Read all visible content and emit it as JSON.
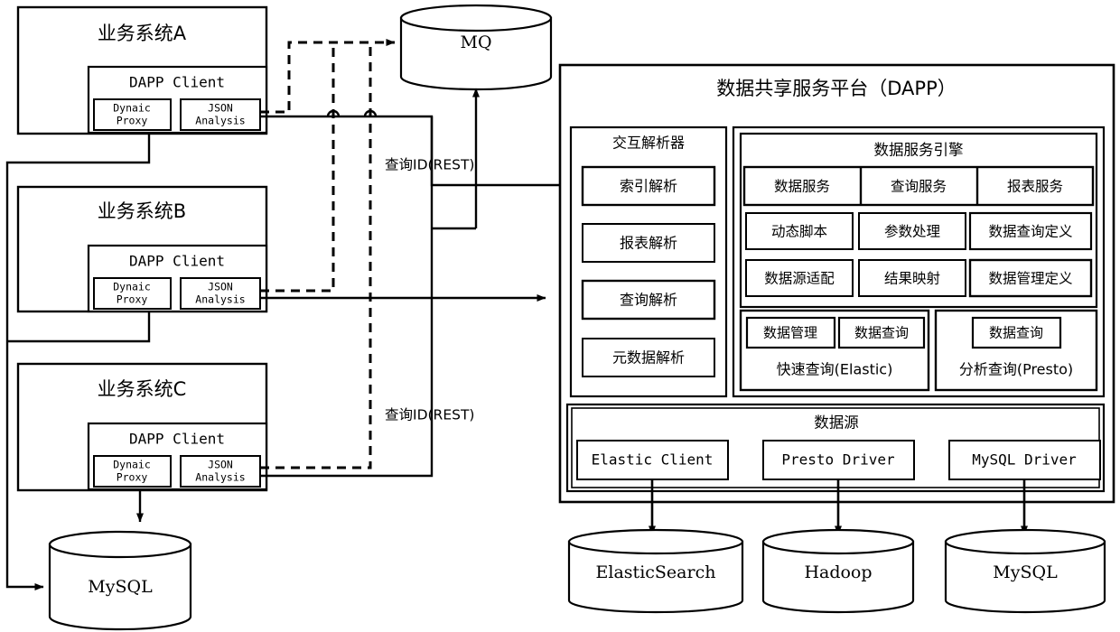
{
  "diagram": {
    "title_hidden": "",
    "colors": {
      "stroke": "#000000",
      "fill": "#ffffff"
    }
  },
  "business_systems": [
    {
      "id": "A",
      "title": "业务系统A",
      "client": {
        "title": "DAPP Client",
        "modules": [
          {
            "line1": "Dynaic",
            "line2": "Proxy"
          },
          {
            "line1": "JSON",
            "line2": "Analysis"
          }
        ]
      }
    },
    {
      "id": "B",
      "title": "业务系统B",
      "client": {
        "title": "DAPP Client",
        "modules": [
          {
            "line1": "Dynaic",
            "line2": "Proxy"
          },
          {
            "line1": "JSON",
            "line2": "Analysis"
          }
        ]
      }
    },
    {
      "id": "C",
      "title": "业务系统C",
      "client": {
        "title": "DAPP Client",
        "modules": [
          {
            "line1": "Dynaic",
            "line2": "Proxy"
          },
          {
            "line1": "JSON",
            "line2": "Analysis"
          }
        ]
      }
    }
  ],
  "queues": {
    "mq": "MQ"
  },
  "left_store": {
    "mysql": "MySQL"
  },
  "edge_labels": {
    "query_id_rest_top": "查询ID(REST)",
    "query_id_rest_bottom": "查询ID(REST)"
  },
  "platform": {
    "title": "数据共享服务平台（DAPP）",
    "parser": {
      "title": "交互解析器",
      "items": [
        "索引解析",
        "报表解析",
        "查询解析",
        "元数据解析"
      ]
    },
    "engine": {
      "title": "数据服务引擎",
      "row1": [
        "数据服务",
        "查询服务",
        "报表服务"
      ],
      "row2": [
        "动态脚本",
        "参数处理",
        "数据查询定义"
      ],
      "row3": [
        "数据源适配",
        "结果映射",
        "数据管理定义"
      ],
      "query_groups": [
        {
          "chips": [
            "数据管理",
            "数据查询"
          ],
          "caption": "快速查询(Elastic)"
        },
        {
          "chips": [
            "数据查询"
          ],
          "caption": "分析查询(Presto)"
        }
      ]
    },
    "datasource": {
      "title": "数据源",
      "drivers": [
        "Elastic Client",
        "Presto Driver",
        "MySQL Driver"
      ]
    }
  },
  "storages": [
    "ElasticSearch",
    "Hadoop",
    "MySQL"
  ]
}
